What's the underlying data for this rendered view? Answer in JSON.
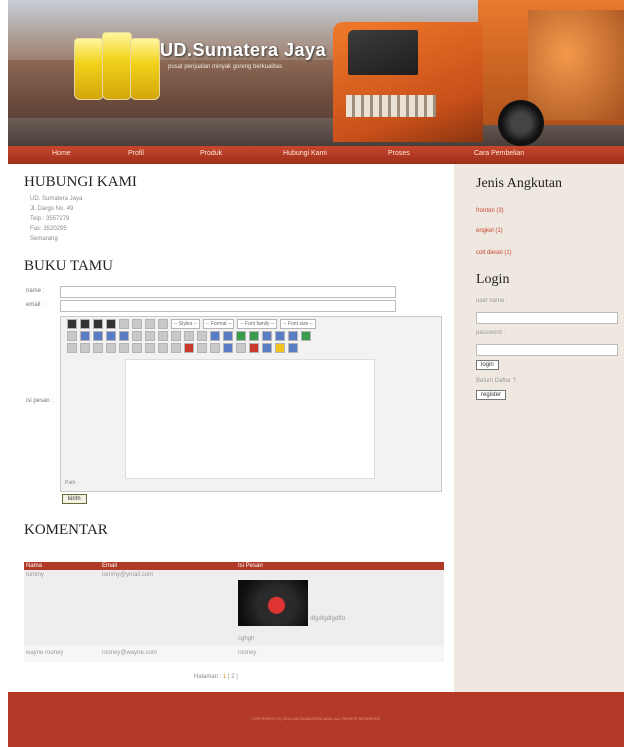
{
  "header": {
    "brand": "UD.Sumatera Jaya",
    "tagline": "pusat penjualan minyak goreng berkualitas"
  },
  "nav": {
    "items": [
      "Home",
      "Profil",
      "Produk",
      "Hubungi Kami",
      "Proses",
      "Cara Pembelian"
    ]
  },
  "contact": {
    "title": "HUBUNGI KAMI",
    "lines": [
      "UD. Sumatera Jaya",
      "Jl. Dargo No. 49",
      "Telp : 3557279",
      "Fax: 3520295",
      "Semarang"
    ]
  },
  "guestbook": {
    "title": "BUKU TAMU",
    "name_label": "name :",
    "email_label": "email :",
    "message_label": "isi pesan :",
    "toolbar": {
      "styles": "-- Styles --",
      "format": "-- Format --",
      "font_family": "-- Font family --",
      "font_size": "-- Font size --"
    },
    "path_label": "Path:",
    "submit_label": "kirim"
  },
  "comments": {
    "title": "KOMENTAR",
    "headers": [
      "Nama",
      "Email",
      "Isi Pesan"
    ],
    "rows": [
      {
        "name": "tommy",
        "email": "tommy@ymail.com",
        "message_a": "dfgdfgdfgdffd",
        "message_b": "cghgh"
      },
      {
        "name": "wayne rooney",
        "email": "rooney@wayne.com",
        "message_a": "rooney",
        "message_b": ""
      }
    ],
    "pager_label": "Halaman :",
    "pager_current": "1",
    "pager_other": "| 2 |"
  },
  "sidebar": {
    "title": "Jenis Angkutan",
    "links": [
      "fronton (3)",
      "engkel (1)",
      "colt diesel (1)"
    ],
    "login_title": "Login",
    "username_label": "user name :",
    "password_label": "password :",
    "login_button": "login",
    "register_prompt": "Belum Daftar ?",
    "register_button": "register"
  },
  "footer": {
    "text": "COPYRIGHT (C) 2013 UD.SUMATERA JAYA. ALL RIGHTS RESERVED"
  }
}
